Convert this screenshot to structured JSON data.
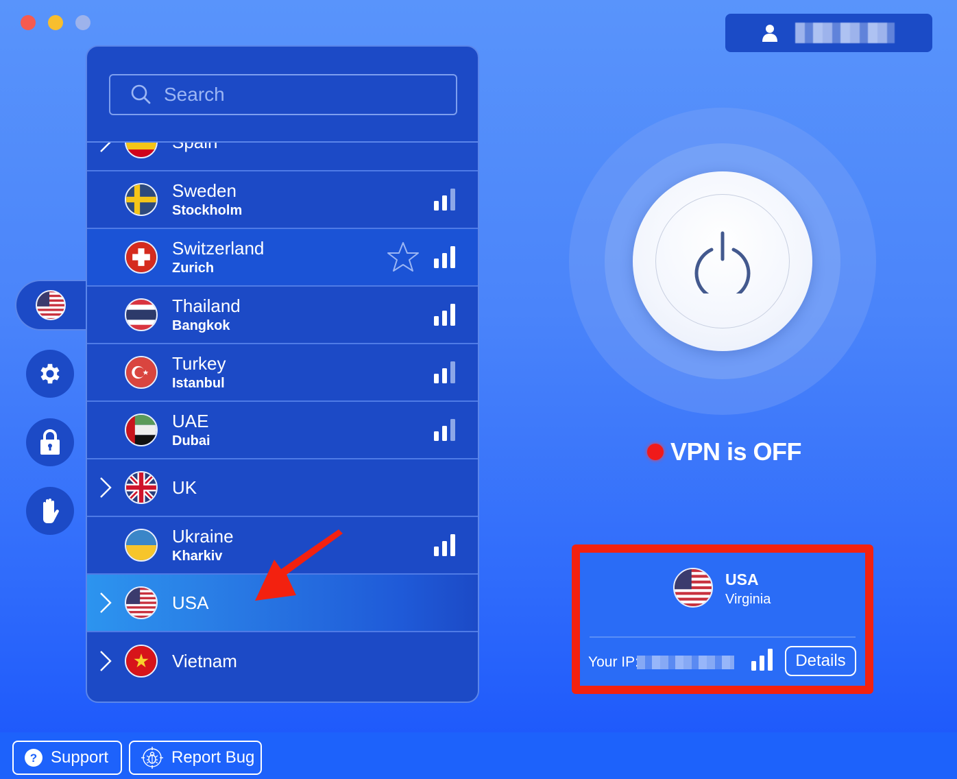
{
  "window": {
    "controls": [
      "close",
      "minimize",
      "zoom"
    ]
  },
  "account": {
    "icon": "user-icon",
    "username": "[redacted]"
  },
  "search": {
    "placeholder": "Search",
    "value": ""
  },
  "sidebar": {
    "items": [
      {
        "name": "location",
        "icon": "us-flag-icon",
        "active": true
      },
      {
        "name": "settings",
        "icon": "gear-icon"
      },
      {
        "name": "security",
        "icon": "lock-icon"
      },
      {
        "name": "blocker",
        "icon": "hand-icon"
      }
    ]
  },
  "servers": [
    {
      "country": "Spain",
      "city": "",
      "expandable": true,
      "flag": "es",
      "signal": 0
    },
    {
      "country": "Sweden",
      "city": "Stockholm",
      "expandable": false,
      "flag": "se",
      "signal": 2
    },
    {
      "country": "Switzerland",
      "city": "Zurich",
      "expandable": false,
      "flag": "ch",
      "signal": 3,
      "hover": true,
      "favorite": false
    },
    {
      "country": "Thailand",
      "city": "Bangkok",
      "expandable": false,
      "flag": "th",
      "signal": 3
    },
    {
      "country": "Turkey",
      "city": "Istanbul",
      "expandable": false,
      "flag": "tr",
      "signal": 2
    },
    {
      "country": "UAE",
      "city": "Dubai",
      "expandable": false,
      "flag": "ae",
      "signal": 2
    },
    {
      "country": "UK",
      "city": "",
      "expandable": true,
      "flag": "gb",
      "signal": 0
    },
    {
      "country": "Ukraine",
      "city": "Kharkiv",
      "expandable": false,
      "flag": "ua",
      "signal": 3
    },
    {
      "country": "USA",
      "city": "",
      "expandable": true,
      "flag": "us",
      "signal": 0,
      "selected": true
    },
    {
      "country": "Vietnam",
      "city": "",
      "expandable": true,
      "flag": "vn",
      "signal": 0
    }
  ],
  "power": {
    "icon": "power-icon"
  },
  "status": {
    "text": "VPN is OFF",
    "color": "#f01a1a"
  },
  "connection": {
    "country": "USA",
    "city": "Virginia",
    "flag": "us",
    "ip_label": "Your IP:",
    "ip_value": "[redacted]",
    "signal": 3,
    "details_label": "Details"
  },
  "footer": {
    "support_label": "Support",
    "report_bug_label": "Report Bug"
  },
  "colors": {
    "background": "#4a84fa",
    "panel": "#1c4ac6",
    "highlight_box": "#f3210f",
    "annotation_arrow": "#f3210f"
  }
}
